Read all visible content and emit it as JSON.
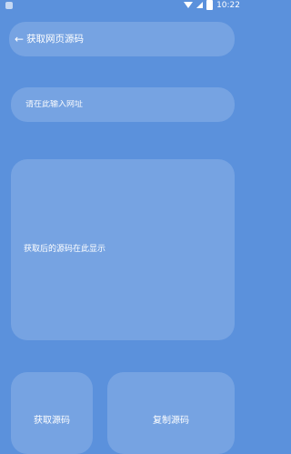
{
  "status_bar": {
    "time": "10:22",
    "icons": [
      "app-icon",
      "wifi-icon",
      "cellular-icon",
      "battery-icon"
    ]
  },
  "header": {
    "back_icon": "back-arrow-icon",
    "back_glyph": "←",
    "title": "获取网页源码"
  },
  "url_field": {
    "placeholder": "请在此输入网址",
    "value": ""
  },
  "output": {
    "placeholder_text": "获取后的源码在此显示"
  },
  "buttons": {
    "fetch_label": "获取源码",
    "copy_label": "复制源码"
  },
  "colors": {
    "background": "#5b91dc",
    "card": "rgba(255,255,255,0.17)",
    "text": "#ffffff"
  }
}
